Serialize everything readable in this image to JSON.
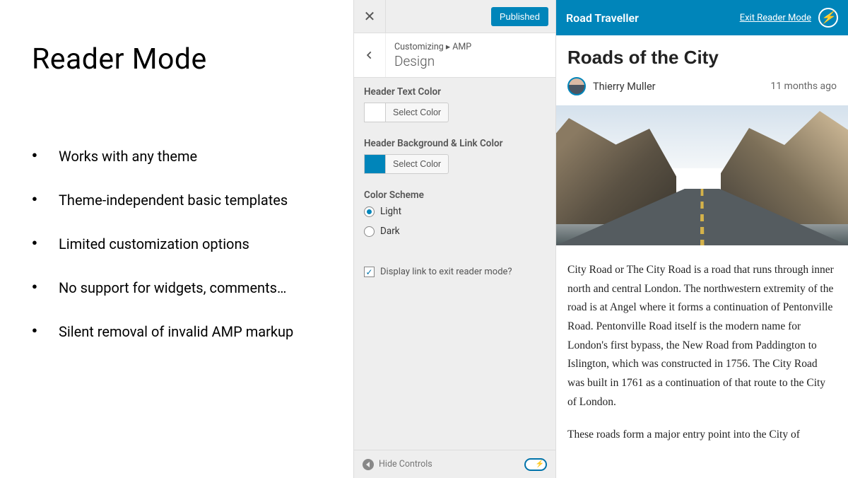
{
  "slide": {
    "title": "Reader Mode",
    "bullets": [
      "Works with any theme",
      "Theme-independent basic templates",
      "Limited customization options",
      "No support for widgets, comments…",
      "Silent removal of invalid AMP markup"
    ]
  },
  "customizer": {
    "close_icon": "✕",
    "published_label": "Published",
    "breadcrumb": "Customizing ▸ AMP",
    "section_title": "Design",
    "header_text_color_label": "Header Text Color",
    "select_color_label": "Select Color",
    "header_bg_label": "Header Background & Link Color",
    "colors": {
      "header_text": "#ffffff",
      "header_bg": "#0085ba"
    },
    "color_scheme_label": "Color Scheme",
    "scheme_options": {
      "light": "Light",
      "dark": "Dark"
    },
    "scheme_selected": "light",
    "exit_link_checkbox_label": "Display link to exit reader mode?",
    "exit_link_checked": true,
    "hide_controls_label": "Hide Controls"
  },
  "preview": {
    "site_title": "Road Traveller",
    "exit_link": "Exit Reader Mode",
    "article_title": "Roads of the City",
    "author": "Thierry Muller",
    "timestamp": "11 months ago",
    "para1": "City Road or The City Road is a road that runs through inner north and central London. The northwestern extremity of the road is at Angel where it forms a continuation of Pentonville Road. Pentonville Road itself is the modern name for London's first bypass, the New Road from Paddington to Islington, which was constructed in 1756. The City Road was built in 1761 as a continuation of that route to the City of London.",
    "para2": "These roads form a major entry point into the City of"
  }
}
